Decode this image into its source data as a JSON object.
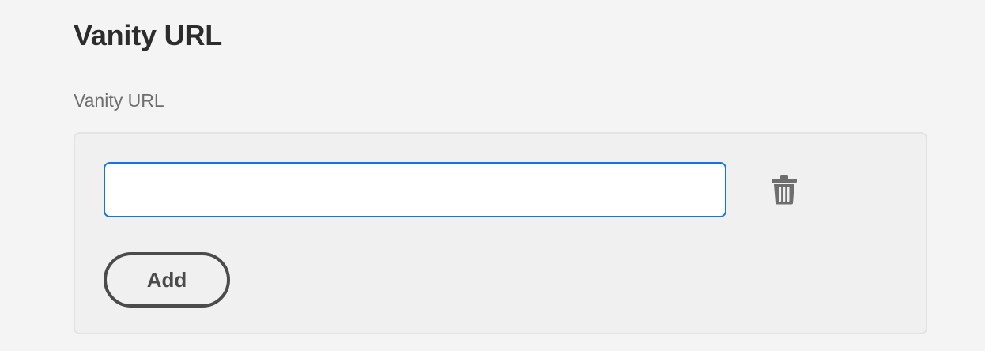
{
  "section": {
    "title": "Vanity URL"
  },
  "field": {
    "label": "Vanity URL",
    "items": [
      {
        "value": "",
        "placeholder": ""
      }
    ],
    "delete_icon": "trash-icon",
    "add_label": "Add"
  },
  "colors": {
    "input_focus_border": "#1473e6",
    "button_border": "#4b4b4b",
    "icon": "#6e6e6e"
  }
}
